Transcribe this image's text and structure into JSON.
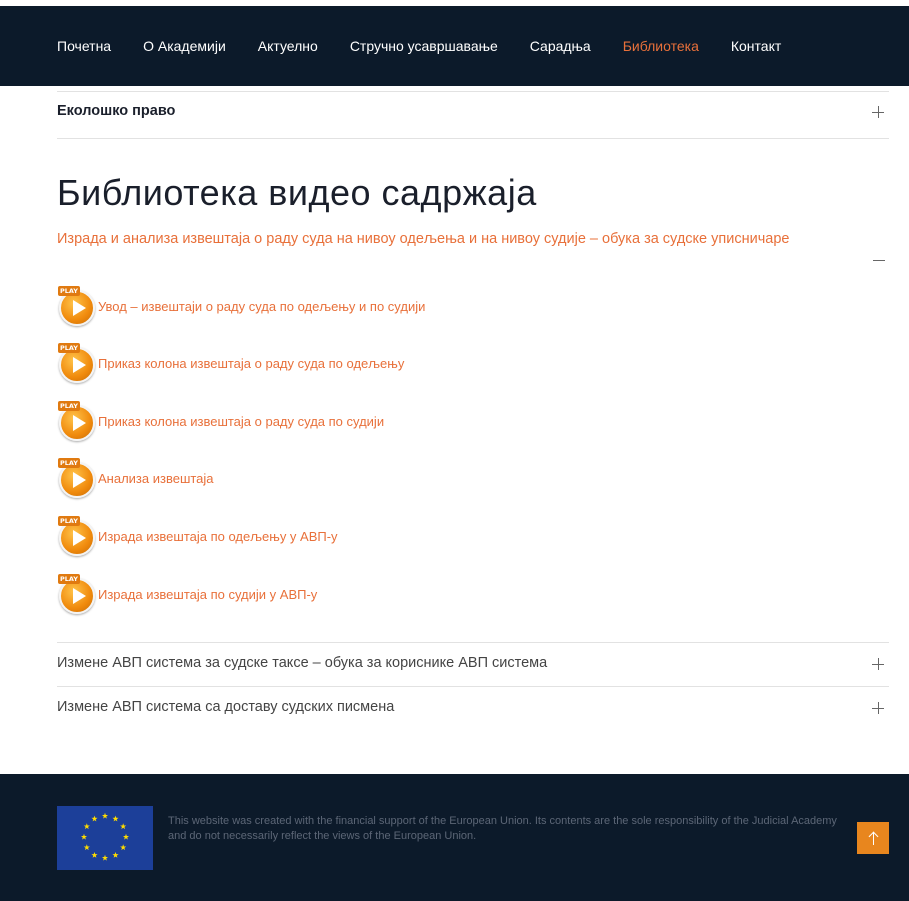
{
  "nav": {
    "items": [
      {
        "label": "Почетна"
      },
      {
        "label": "О Академији"
      },
      {
        "label": "Актуелно"
      },
      {
        "label": "Стручно усавршавање"
      },
      {
        "label": "Сарадња"
      },
      {
        "label": "Библиотека",
        "active": true
      },
      {
        "label": "Контакт"
      }
    ]
  },
  "accordion_top": {
    "title": "Еколошко право"
  },
  "section": {
    "title": "Библиотека видео садржаја",
    "subtitle": "Израда и анализа извештаја о раду суда на нивоу одељења и на нивоу судије – обука за судске уписничаре"
  },
  "play_badge": "PLAY",
  "videos": [
    {
      "label": "Увод – извештаји о раду суда по одељењу и по судији"
    },
    {
      "label": "Приказ колона извештаја о раду суда по одељењу"
    },
    {
      "label": "Приказ колона извештаја о раду суда по судији"
    },
    {
      "label": "Анализа извештаја"
    },
    {
      "label": "Израда извештаја по одељењу у АВП-у"
    },
    {
      "label": "Израда извештаја по судији у АВП-у"
    }
  ],
  "accordion_bottom": [
    {
      "title": "Измене АВП система за судске таксе – обука за кориснике АВП система"
    },
    {
      "title": "Измене АВП система са доставу судских писмена"
    }
  ],
  "footer": {
    "text": "This website was created with the financial support of the European Union. Its contents are the sole responsibility of the Judicial Academy and do not necessarily reflect the views of the European Union."
  },
  "colors": {
    "accent": "#e8703a",
    "navy": "#0c1a2a",
    "eu_blue": "#1c3f99",
    "eu_star": "#ffdd00"
  },
  "icons": {
    "expand": "plus-icon",
    "collapse": "minus-icon",
    "video": "play-icon",
    "scroll_top": "arrow-up-icon"
  }
}
